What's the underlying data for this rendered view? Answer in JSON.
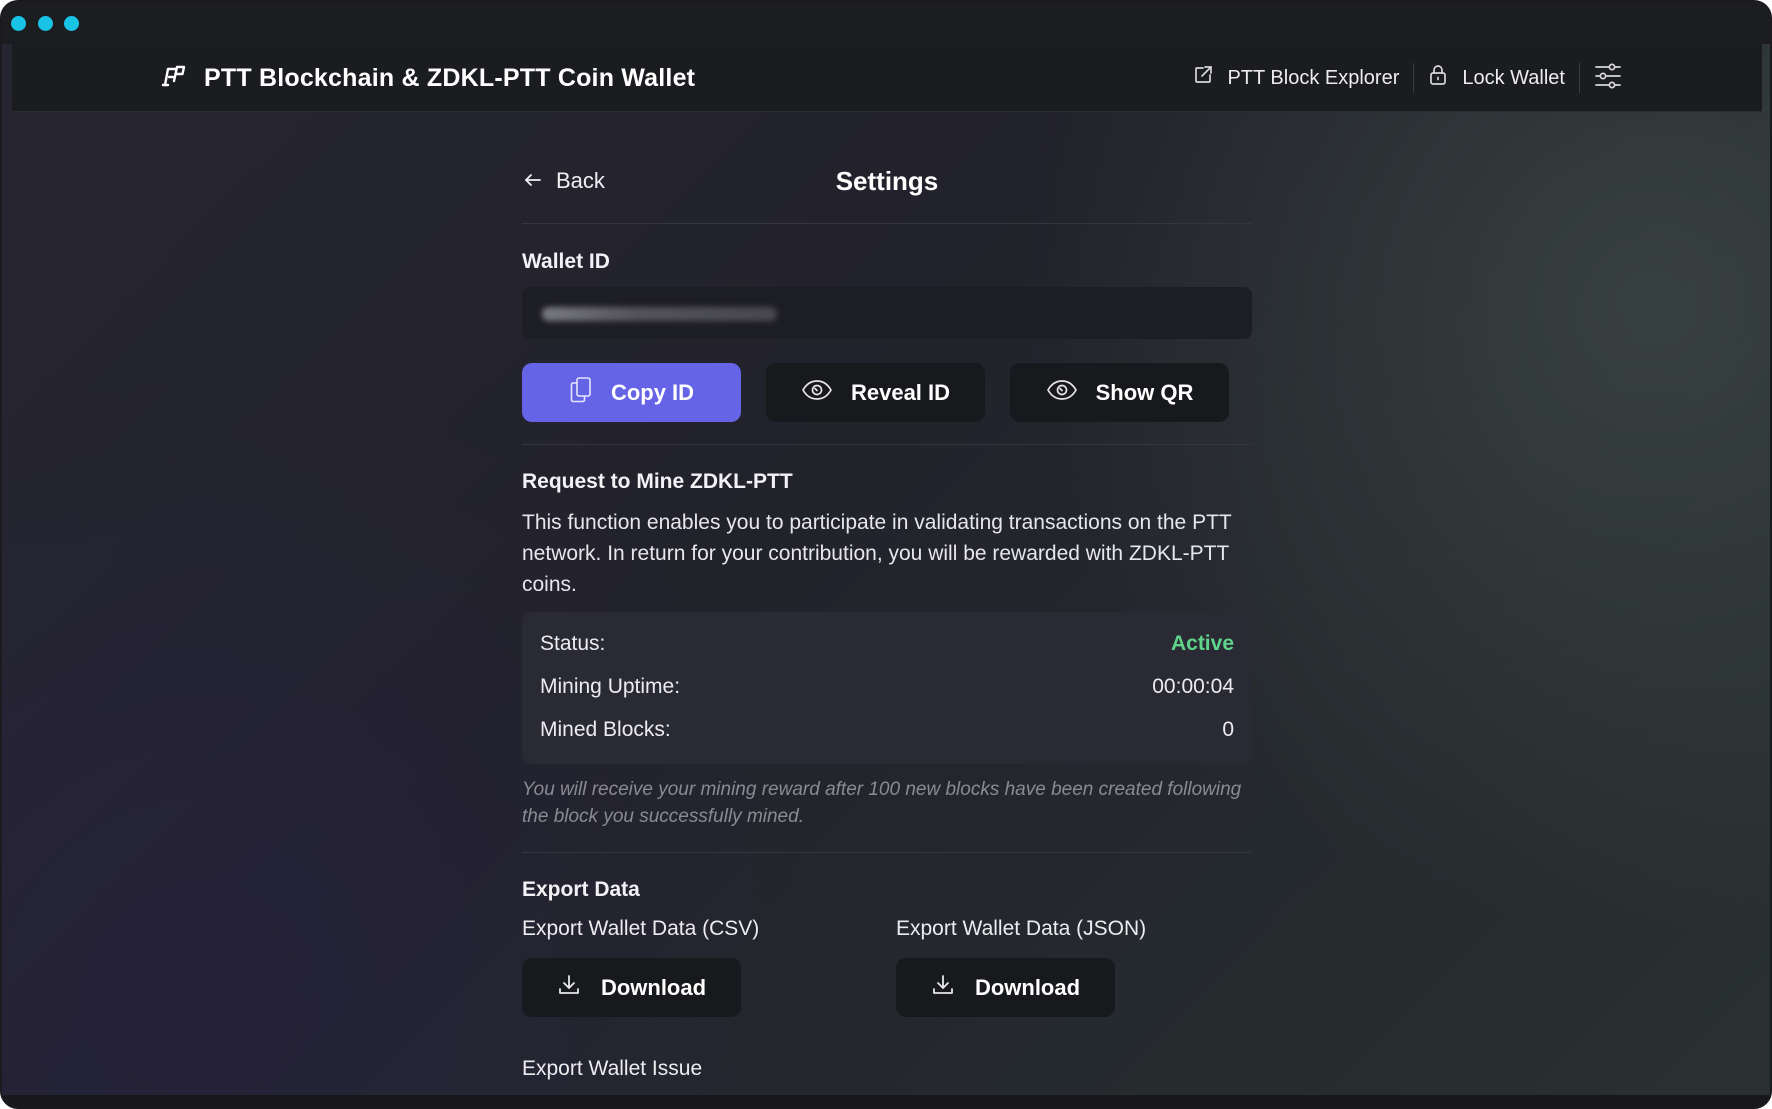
{
  "app": {
    "title": "PTT Blockchain & ZDKL-PTT Coin Wallet",
    "logo_icon": "ptt-logo-icon"
  },
  "nav": {
    "explorer_label": "PTT Block Explorer",
    "explorer_icon": "external-link-icon",
    "lock_label": "Lock Wallet",
    "lock_icon": "lock-icon",
    "menu_icon": "sliders-icon"
  },
  "page": {
    "back_label": "Back",
    "title": "Settings"
  },
  "wallet": {
    "label": "Wallet ID",
    "value_hidden": true,
    "buttons": {
      "copy": "Copy ID",
      "reveal": "Reveal ID",
      "qr": "Show QR"
    }
  },
  "mining": {
    "title": "Request to Mine ZDKL-PTT",
    "description": "This function enables you to participate in validating transactions on the PTT network. In return for your contribution, you will be rewarded with ZDKL-PTT coins.",
    "status_label": "Status:",
    "status_value": "Active",
    "uptime_label": "Mining Uptime:",
    "uptime_value": "00:00:04",
    "blocks_label": "Mined Blocks:",
    "blocks_value": "0",
    "note": "You will receive your mining reward after 100 new blocks have been created following the block you successfully mined."
  },
  "export": {
    "title": "Export Data",
    "csv_label": "Export Wallet Data (CSV)",
    "json_label": "Export Wallet Data (JSON)",
    "download_label": "Download",
    "issue_label": "Export Wallet Issue"
  },
  "colors": {
    "accent": "#6563e6",
    "active": "#5fd38a",
    "window_dots": "#19c3e6"
  }
}
